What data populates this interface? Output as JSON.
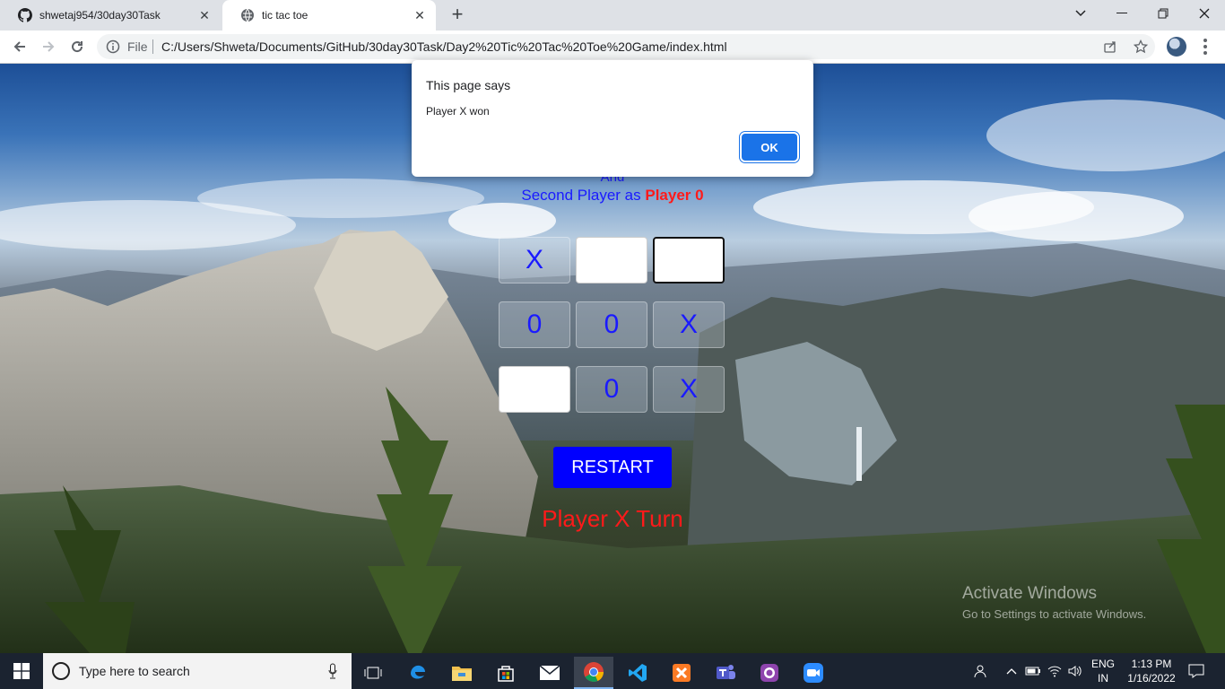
{
  "browser": {
    "tabs": [
      {
        "title": "shwetaj954/30day30Task",
        "icon": "github-icon",
        "active": false
      },
      {
        "title": "tic tac toe",
        "icon": "globe-icon",
        "active": true
      }
    ],
    "new_tab": "+",
    "address": {
      "scheme_label": "File",
      "url": "C:/Users/Shweta/Documents/GitHub/30day30Task/Day2%20Tic%20Tac%20Toe%20Game/index.html"
    }
  },
  "dialog": {
    "title": "This page says",
    "message": "Player X won",
    "ok_label": "OK"
  },
  "game": {
    "intro_partial": "And",
    "second_player_prefix": "Second Player as",
    "second_player_name": "Player 0",
    "board": [
      [
        "X",
        "",
        ""
      ],
      [
        "0",
        "0",
        "X"
      ],
      [
        "",
        "0",
        "X"
      ]
    ],
    "restart_label": "RESTART",
    "turn_text": "Player X Turn"
  },
  "watermark": {
    "line1": "Activate Windows",
    "line2": "Go to Settings to activate Windows."
  },
  "taskbar": {
    "search_placeholder": "Type here to search",
    "lang_top": "ENG",
    "lang_bottom": "IN",
    "time": "1:13 PM",
    "date": "1/16/2022",
    "pinned": [
      "task-view-icon",
      "edge-icon",
      "file-explorer-icon",
      "store-icon",
      "mail-icon",
      "chrome-icon",
      "vscode-icon",
      "xampp-icon",
      "teams-icon",
      "github-desktop-icon",
      "zoom-icon"
    ]
  },
  "colors": {
    "player_text": "#1a1aff",
    "accent_red": "#ff1a1a",
    "restart_bg": "#0000ff",
    "dialog_ok": "#1a73e8"
  }
}
